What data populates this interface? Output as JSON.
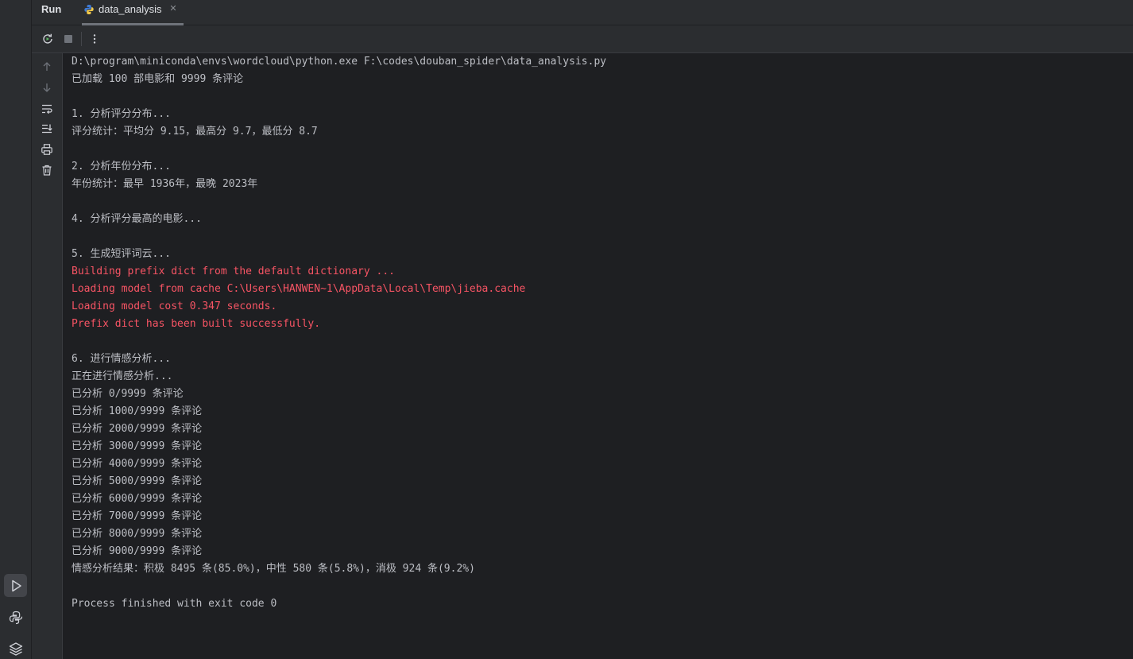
{
  "header": {
    "title": "Run",
    "tab": {
      "label": "data_analysis",
      "close_glyph": "✕"
    }
  },
  "toolbar": {
    "buttons": [
      "rerun-icon",
      "stop-icon",
      "more-options-icon"
    ]
  },
  "gutter": {
    "buttons": [
      "arrow-up-icon",
      "arrow-down-icon",
      "soft-wrap-icon",
      "scroll-to-end-icon",
      "print-icon",
      "trash-icon"
    ]
  },
  "activity_bar": {
    "buttons": [
      "run-icon",
      "python-console-icon",
      "layers-icon"
    ]
  },
  "colors": {
    "stdout": "#bcbec4",
    "stderr": "#f75464",
    "background": "#1e1f22",
    "panel": "#2b2d30"
  },
  "console": {
    "lines": [
      {
        "text": "D:\\program\\miniconda\\envs\\wordcloud\\python.exe F:\\codes\\douban_spider\\data_analysis.py",
        "type": "out"
      },
      {
        "text": "已加载 100 部电影和 9999 条评论",
        "type": "out"
      },
      {
        "text": "",
        "type": "out"
      },
      {
        "text": "1. 分析评分分布...",
        "type": "out"
      },
      {
        "text": "评分统计：平均分 9.15，最高分 9.7，最低分 8.7",
        "type": "out"
      },
      {
        "text": "",
        "type": "out"
      },
      {
        "text": "2. 分析年份分布...",
        "type": "out"
      },
      {
        "text": "年份统计：最早 1936年，最晚 2023年",
        "type": "out"
      },
      {
        "text": "",
        "type": "out"
      },
      {
        "text": "4. 分析评分最高的电影...",
        "type": "out"
      },
      {
        "text": "",
        "type": "out"
      },
      {
        "text": "5. 生成短评词云...",
        "type": "out"
      },
      {
        "text": "Building prefix dict from the default dictionary ...",
        "type": "err"
      },
      {
        "text": "Loading model from cache C:\\Users\\HANWEN~1\\AppData\\Local\\Temp\\jieba.cache",
        "type": "err"
      },
      {
        "text": "Loading model cost 0.347 seconds.",
        "type": "err"
      },
      {
        "text": "Prefix dict has been built successfully.",
        "type": "err"
      },
      {
        "text": "",
        "type": "out"
      },
      {
        "text": "6. 进行情感分析...",
        "type": "out"
      },
      {
        "text": "正在进行情感分析...",
        "type": "out"
      },
      {
        "text": "已分析 0/9999 条评论",
        "type": "out"
      },
      {
        "text": "已分析 1000/9999 条评论",
        "type": "out"
      },
      {
        "text": "已分析 2000/9999 条评论",
        "type": "out"
      },
      {
        "text": "已分析 3000/9999 条评论",
        "type": "out"
      },
      {
        "text": "已分析 4000/9999 条评论",
        "type": "out"
      },
      {
        "text": "已分析 5000/9999 条评论",
        "type": "out"
      },
      {
        "text": "已分析 6000/9999 条评论",
        "type": "out"
      },
      {
        "text": "已分析 7000/9999 条评论",
        "type": "out"
      },
      {
        "text": "已分析 8000/9999 条评论",
        "type": "out"
      },
      {
        "text": "已分析 9000/9999 条评论",
        "type": "out"
      },
      {
        "text": "情感分析结果：积极 8495 条(85.0%)，中性 580 条(5.8%)，消极 924 条(9.2%)",
        "type": "out"
      },
      {
        "text": "",
        "type": "out"
      },
      {
        "text": "Process finished with exit code 0",
        "type": "out"
      }
    ]
  }
}
